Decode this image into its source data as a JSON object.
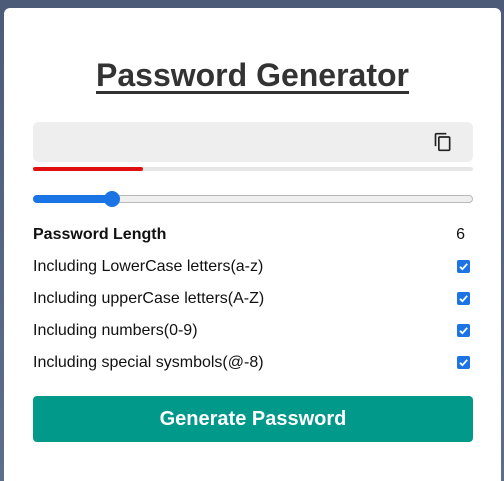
{
  "app": {
    "title": "Password Generator"
  },
  "password": {
    "value": "",
    "placeholder": ""
  },
  "icons": {
    "copy": "copy-icon"
  },
  "strength": {
    "fraction": 0.25,
    "color": "#e01010"
  },
  "length": {
    "label": "Password Length",
    "value": "6",
    "slider_fraction": 0.18
  },
  "options": [
    {
      "label": "Including LowerCase letters(a-z)",
      "checked": true
    },
    {
      "label": "Including upperCase letters(A-Z)",
      "checked": true
    },
    {
      "label": "Including numbers(0-9)",
      "checked": true
    },
    {
      "label": "Including special sysmbols(@-8)",
      "checked": true
    }
  ],
  "generate": {
    "label": "Generate Password"
  },
  "colors": {
    "accent": "#1b74e4",
    "button": "#00998a",
    "strength_weak": "#e01010"
  }
}
